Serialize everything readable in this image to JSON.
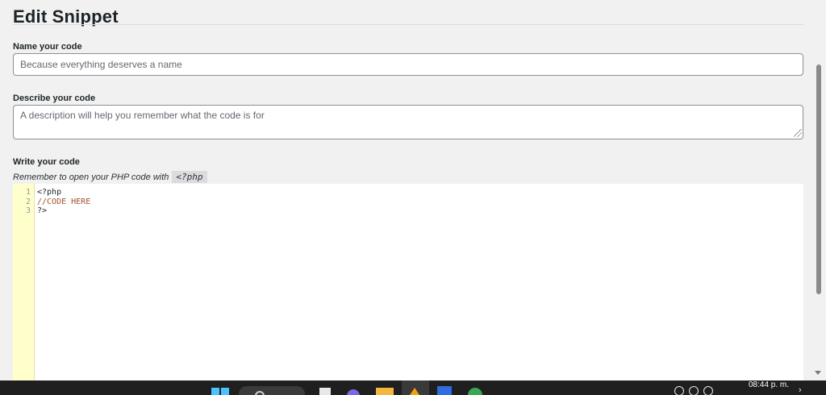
{
  "form": {
    "title": "Edit Snippet",
    "name_label": "Name your code",
    "name_placeholder": "Because everything deserves a name",
    "name_value": "",
    "description_label": "Describe your code",
    "description_placeholder": "A description will help you remember what the code is for",
    "description_value": "",
    "code_label": "Write your code",
    "code_hint": "Remember to open your PHP code with",
    "code_hint_chip": "<?php"
  },
  "editor": {
    "line_numbers": [
      "1",
      "2",
      "3"
    ],
    "lines": [
      "<?php",
      "//CODE HERE",
      "?>"
    ],
    "comment_color": "#a0522d",
    "gutter_color": "#ffffcc"
  },
  "taskbar": {
    "clock_time": "08:44 p. m.",
    "icons": [
      "windows-start-icon",
      "search-icon",
      "task-view-icon",
      "chat-icon",
      "file-explorer-icon",
      "pinned-app-icon",
      "store-icon",
      "browser-icon"
    ]
  }
}
